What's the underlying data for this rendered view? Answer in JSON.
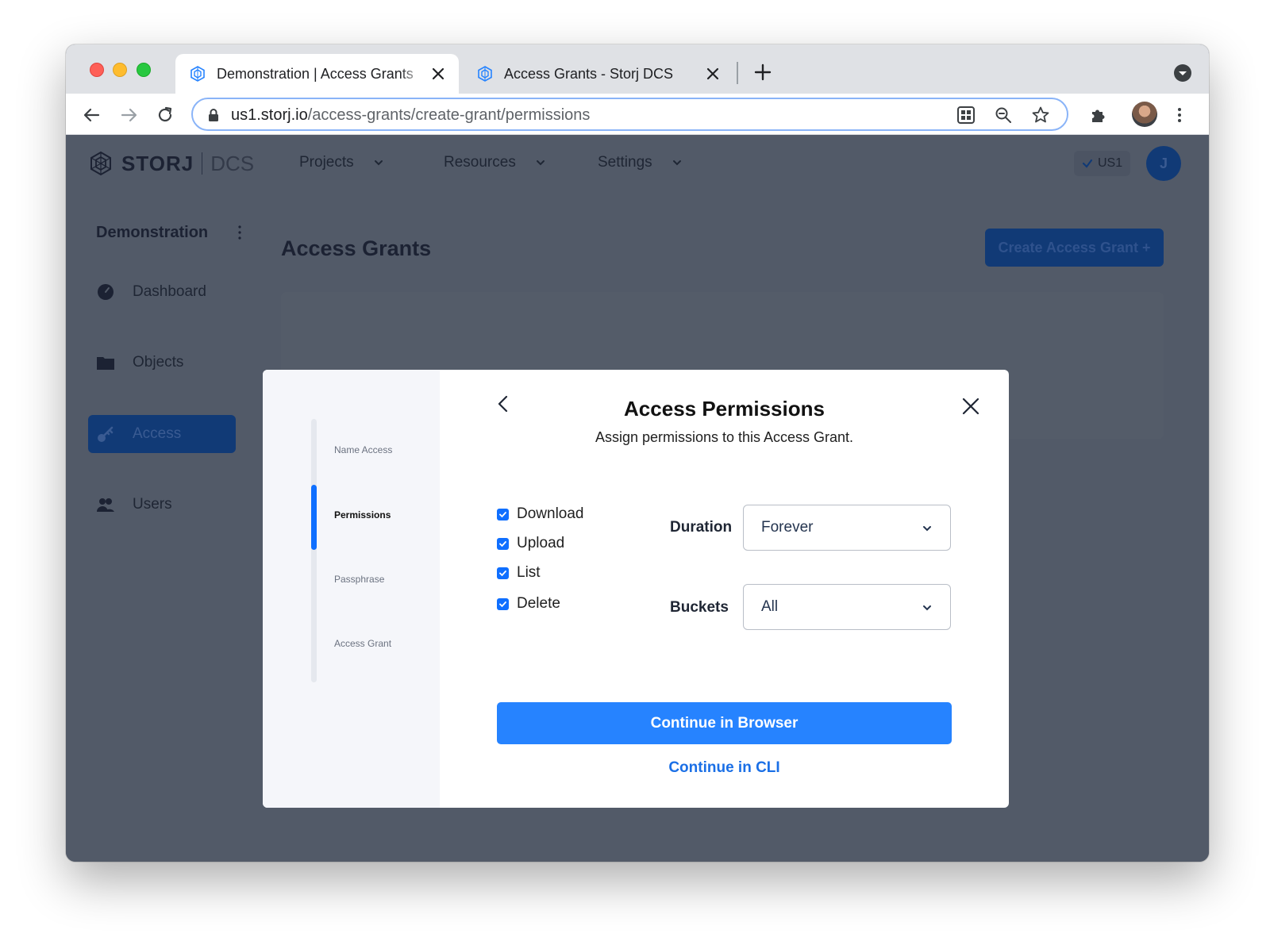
{
  "browser": {
    "tabs": [
      {
        "title": "Demonstration | Access Grants",
        "active": true
      },
      {
        "title": "Access Grants - Storj DCS",
        "active": false
      }
    ],
    "url_host": "us1.storj.io",
    "url_path": "/access-grants/create-grant/permissions"
  },
  "app": {
    "logo": {
      "brand": "STORJ",
      "product": "DCS"
    },
    "nav": [
      {
        "label": "Projects"
      },
      {
        "label": "Resources"
      },
      {
        "label": "Settings"
      }
    ],
    "region": "US1",
    "user_initial": "J"
  },
  "sidebar": {
    "project_name": "Demonstration",
    "items": [
      {
        "label": "Dashboard",
        "icon": "dashboard-icon"
      },
      {
        "label": "Objects",
        "icon": "folder-icon"
      },
      {
        "label": "Access",
        "icon": "key-icon",
        "active": true
      },
      {
        "label": "Users",
        "icon": "users-icon"
      }
    ]
  },
  "main": {
    "title": "Access Grants",
    "create_button": "Create Access Grant +"
  },
  "modal": {
    "steps": [
      {
        "label": "Name Access"
      },
      {
        "label": "Permissions",
        "current": true
      },
      {
        "label": "Passphrase"
      },
      {
        "label": "Access Grant"
      }
    ],
    "title": "Access Permissions",
    "subtitle": "Assign permissions to this Access Grant.",
    "permissions": [
      {
        "label": "Download",
        "checked": true
      },
      {
        "label": "Upload",
        "checked": true
      },
      {
        "label": "List",
        "checked": true
      },
      {
        "label": "Delete",
        "checked": true
      }
    ],
    "duration": {
      "label": "Duration",
      "value": "Forever"
    },
    "buckets": {
      "label": "Buckets",
      "value": "All"
    },
    "primary_button": "Continue in Browser",
    "secondary_link": "Continue in CLI"
  },
  "colors": {
    "accent": "#2683ff",
    "link": "#1a6fe6",
    "step_active": "#0f6fff",
    "overlay_bg": "#525a68"
  }
}
